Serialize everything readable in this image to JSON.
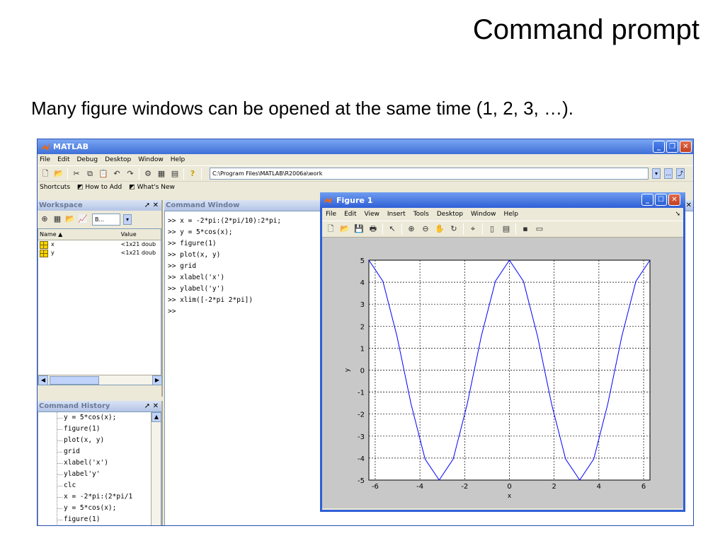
{
  "slide": {
    "title": "Command prompt",
    "subtitle": "Many figure windows can be opened at the same time (1, 2, 3, …)."
  },
  "matlab": {
    "title": "MATLAB",
    "menu": [
      "File",
      "Edit",
      "Debug",
      "Desktop",
      "Window",
      "Help"
    ],
    "current_directory": "C:\\Program Files\\MATLAB\\R2006a\\work",
    "shortcuts": {
      "label": "Shortcuts",
      "how_to_add": "How to Add",
      "whats_new": "What's New"
    },
    "workspace": {
      "title": "Workspace",
      "dropdown": "B...",
      "columns": [
        "Name ▲",
        "Value"
      ],
      "rows": [
        {
          "name": "x",
          "value": "<1x21 doub"
        },
        {
          "name": "y",
          "value": "<1x21 doub"
        }
      ]
    },
    "command_history": {
      "title": "Command History",
      "lines": [
        "y = 5*cos(x);",
        "figure(1)",
        "plot(x, y)",
        "grid",
        "xlabel('x')",
        "ylabel'y'",
        "clc",
        "x = -2*pi:(2*pi/1",
        "y = 5*cos(x);",
        "figure(1)"
      ]
    },
    "command_window": {
      "title": "Command Window",
      "lines": [
        ">> x = -2*pi:(2*pi/10):2*pi;",
        ">> y = 5*cos(x);",
        ">> figure(1)",
        ">> plot(x, y)",
        ">> grid",
        ">> xlabel('x')",
        ">> ylabel('y')",
        ">> xlim([-2*pi 2*pi])",
        ">>"
      ]
    }
  },
  "figure": {
    "title": "Figure 1",
    "menu": [
      "File",
      "Edit",
      "View",
      "Insert",
      "Tools",
      "Desktop",
      "Window",
      "Help"
    ]
  },
  "chart_data": {
    "type": "line",
    "title": "",
    "xlabel": "x",
    "ylabel": "y",
    "xlim": [
      -6.2832,
      6.2832
    ],
    "ylim": [
      -5,
      5
    ],
    "grid": true,
    "xticks": [
      -6,
      -4,
      -2,
      0,
      2,
      4,
      6
    ],
    "yticks": [
      -5,
      -4,
      -3,
      -2,
      -1,
      0,
      1,
      2,
      3,
      4,
      5
    ],
    "line_color": "#0000ff",
    "series": [
      {
        "x": [
          -6.2832,
          -5.6549,
          -5.0265,
          -4.3982,
          -3.7699,
          -3.1416,
          -2.5133,
          -1.885,
          -1.2566,
          -0.6283,
          0,
          0.6283,
          1.2566,
          1.885,
          2.5133,
          3.1416,
          3.7699,
          4.3982,
          5.0265,
          5.6549,
          6.2832
        ],
        "y": [
          5,
          4.045,
          1.545,
          -1.545,
          -4.045,
          -5,
          -4.045,
          -1.545,
          1.545,
          4.045,
          5,
          4.045,
          1.545,
          -1.545,
          -4.045,
          -5,
          -4.045,
          -1.545,
          1.545,
          4.045,
          5
        ]
      }
    ]
  }
}
